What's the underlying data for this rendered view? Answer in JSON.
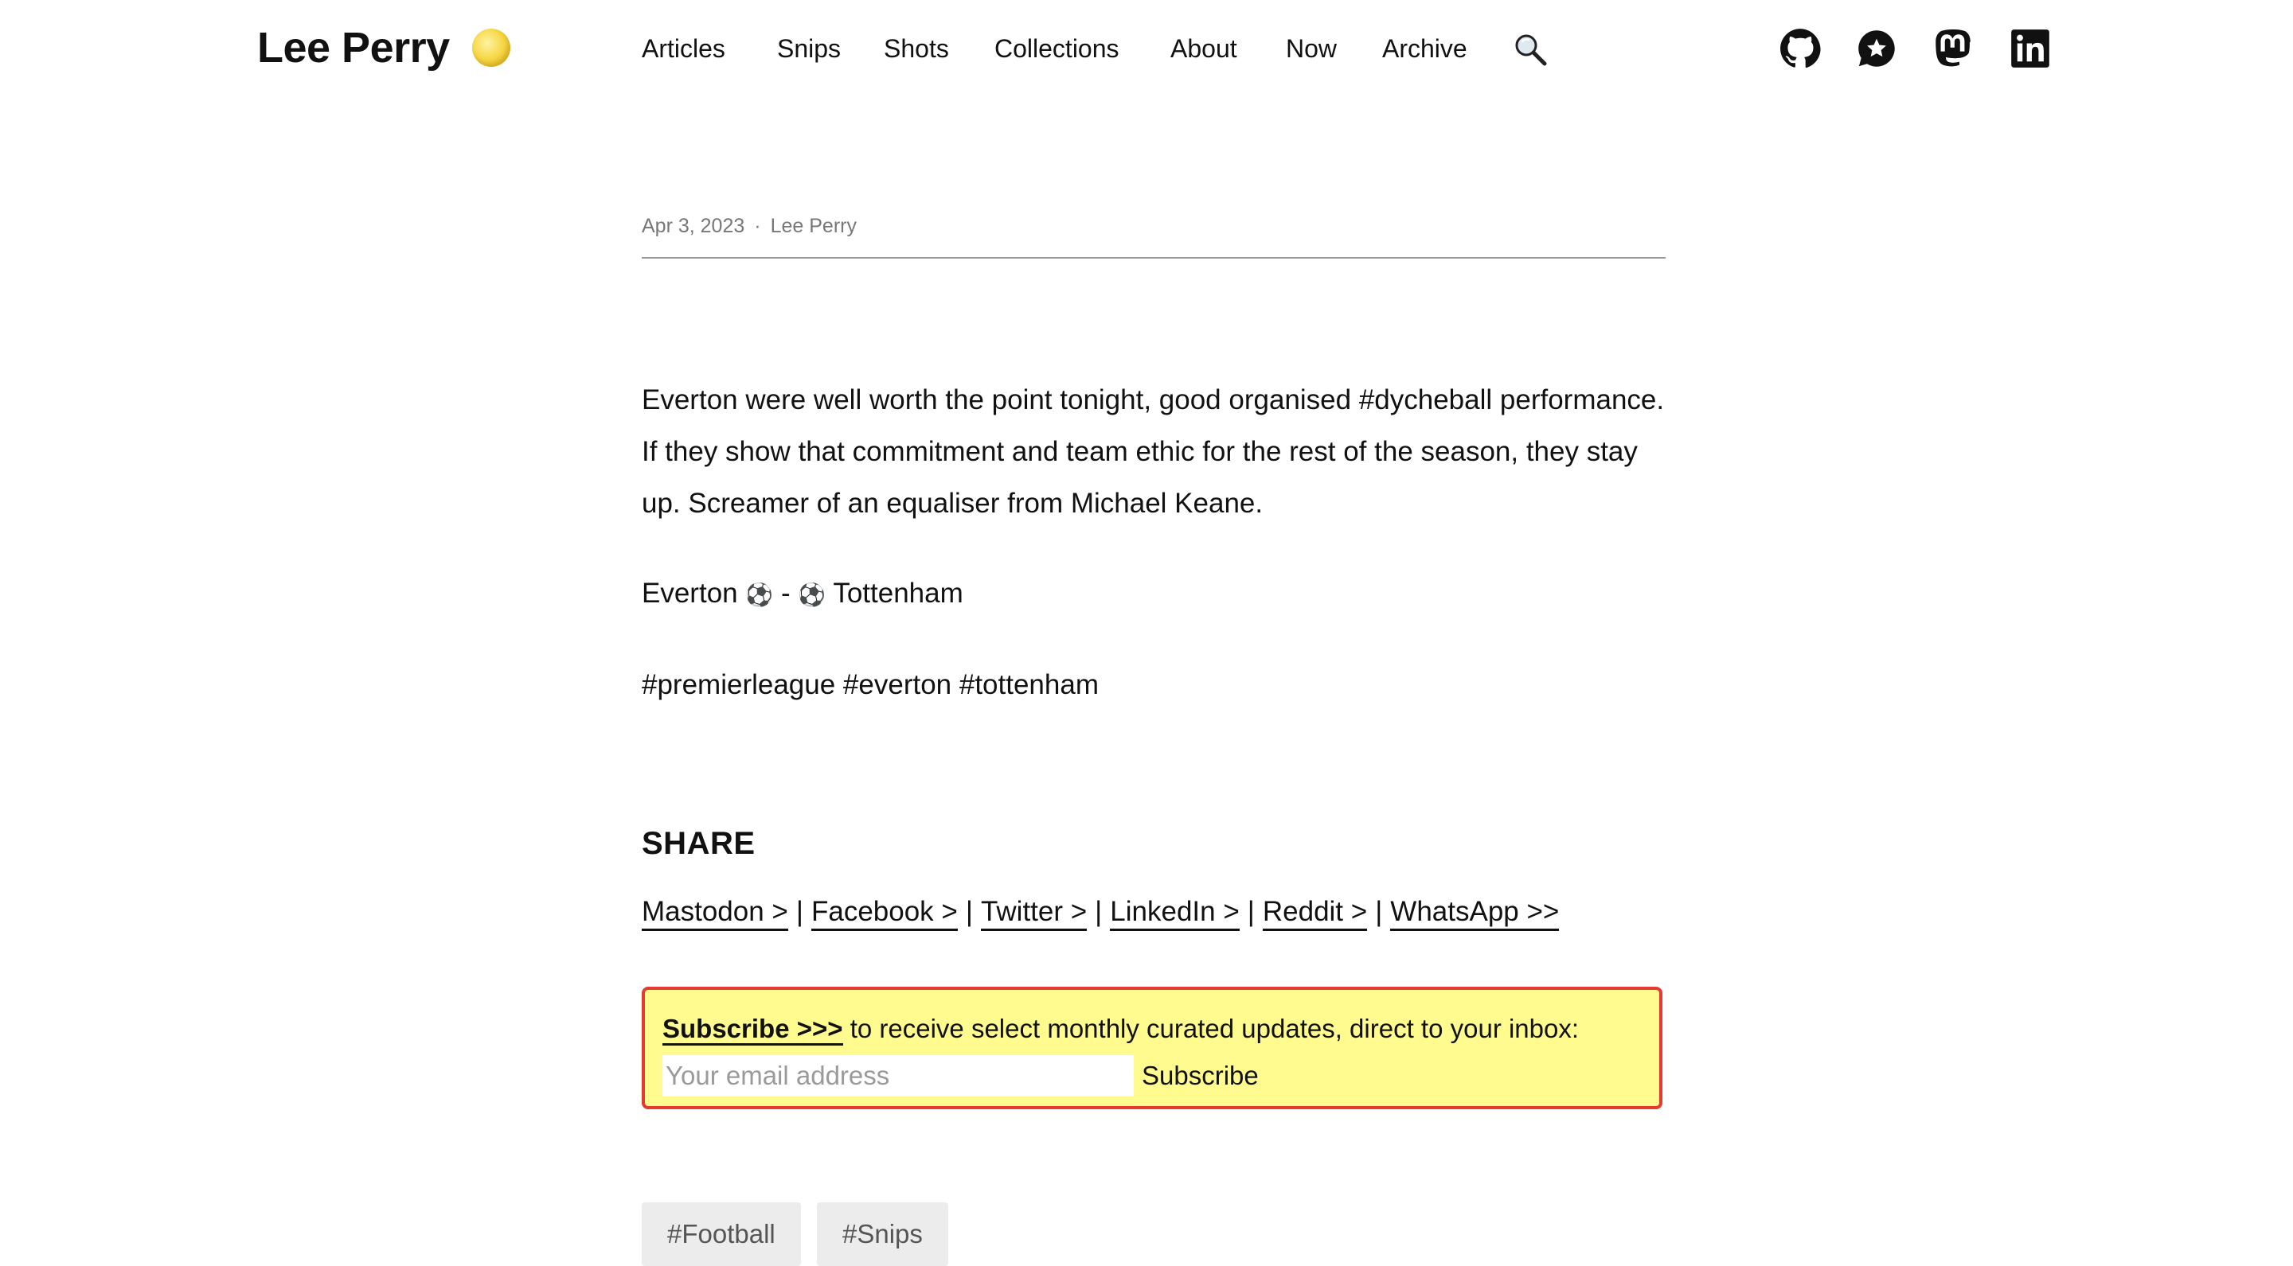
{
  "site": {
    "title": "Lee Perry",
    "logo_icon": "sun-emoji-icon"
  },
  "nav": {
    "items": [
      "Articles",
      "Snips",
      "Shots",
      "Collections",
      "About",
      "Now",
      "Archive"
    ],
    "search_icon": "magnifying-glass-icon"
  },
  "social": {
    "icons": [
      "github-icon",
      "star-bubble-icon",
      "mastodon-icon",
      "linkedin-icon"
    ]
  },
  "post": {
    "date": "Apr 3, 2023",
    "separator": "·",
    "author": "Lee Perry",
    "paragraph1": "Everton were well worth the point tonight, good organised #dycheball performance. If they show that commitment and team ethic for the rest of the season, they stay up. Screamer of an equaliser from Michael Keane.",
    "score": {
      "home": "Everton",
      "away": "Tottenham",
      "ball": "⚽",
      "dash": "-"
    },
    "hashtags": "#premierleague #everton #tottenham"
  },
  "share": {
    "heading": "SHARE",
    "links": [
      "Mastodon >",
      "Facebook >",
      "Twitter >",
      "LinkedIn >",
      "Reddit >",
      "WhatsApp >>"
    ],
    "separator": "|"
  },
  "subscribe": {
    "link_label": "Subscribe >>>",
    "text": " to receive select monthly curated updates, direct to your inbox:",
    "email_placeholder": "Your email address",
    "email_value": "",
    "button_label": "Subscribe",
    "border_color": "#e43a2f",
    "background_color": "#fffb8f"
  },
  "tags": [
    "#Football",
    "#Snips"
  ]
}
